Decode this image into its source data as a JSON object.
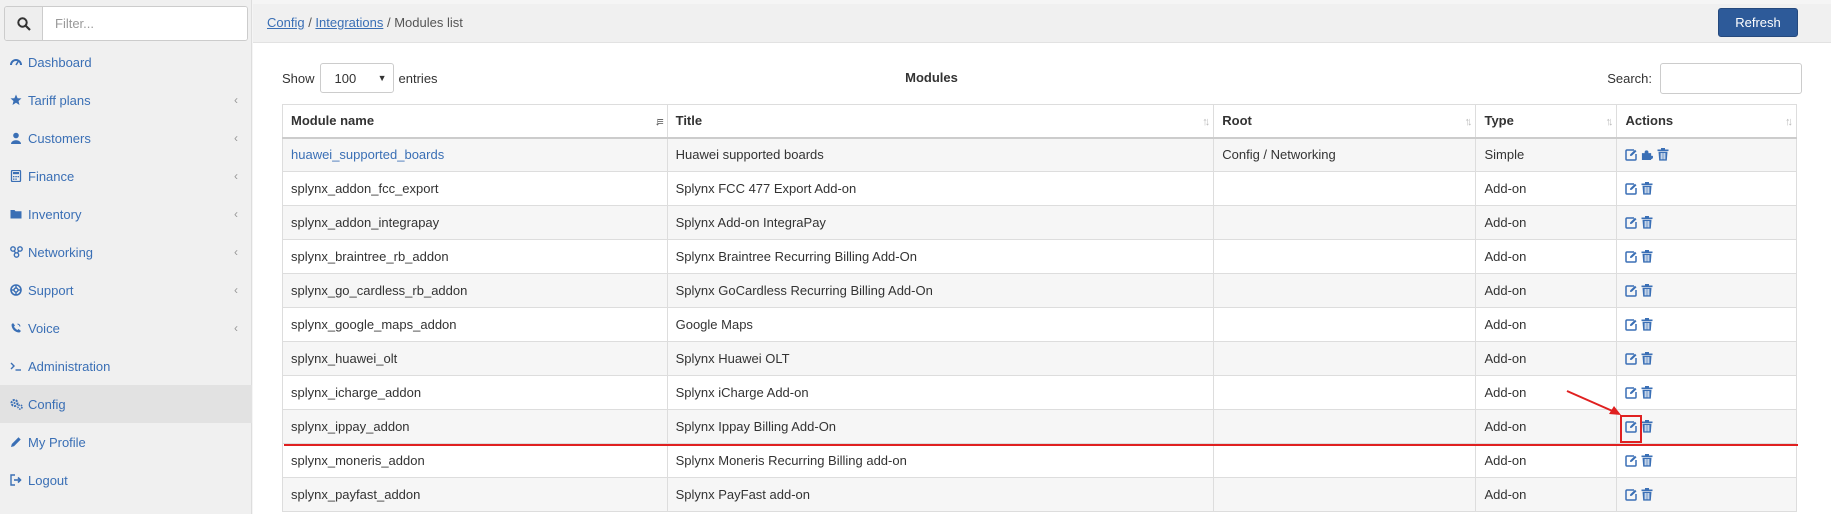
{
  "sidebar": {
    "filter_placeholder": "Filter...",
    "items": [
      {
        "label": "Dashboard",
        "icon": "dashboard-icon",
        "has_chevron": false
      },
      {
        "label": "Tariff plans",
        "icon": "star-icon",
        "has_chevron": true
      },
      {
        "label": "Customers",
        "icon": "user-icon",
        "has_chevron": true
      },
      {
        "label": "Finance",
        "icon": "calculator-icon",
        "has_chevron": true
      },
      {
        "label": "Inventory",
        "icon": "folder-icon",
        "has_chevron": true
      },
      {
        "label": "Networking",
        "icon": "network-icon",
        "has_chevron": true
      },
      {
        "label": "Support",
        "icon": "lifebuoy-icon",
        "has_chevron": true
      },
      {
        "label": "Voice",
        "icon": "phone-icon",
        "has_chevron": true
      },
      {
        "label": "Administration",
        "icon": "terminal-icon",
        "has_chevron": false
      },
      {
        "label": "Config",
        "icon": "gears-icon",
        "has_chevron": false,
        "active": true
      },
      {
        "label": "My Profile",
        "icon": "pencil-icon",
        "has_chevron": false
      },
      {
        "label": "Logout",
        "icon": "logout-icon",
        "has_chevron": false
      }
    ]
  },
  "header": {
    "breadcrumb": {
      "config": "Config",
      "sep1": " / ",
      "integrations": "Integrations",
      "sep2": " / ",
      "current": "Modules list"
    },
    "refresh_label": "Refresh"
  },
  "table": {
    "show_label": "Show",
    "entries_value": "100",
    "entries_label": "entries",
    "title": "Modules",
    "search_label": "Search:",
    "columns": [
      "Module name",
      "Title",
      "Root",
      "Type",
      "Actions"
    ],
    "rows": [
      {
        "name": "huawei_supported_boards",
        "title": "Huawei supported boards",
        "root": "Config / Networking",
        "type": "Simple",
        "link": true,
        "extra_action": true
      },
      {
        "name": "splynx_addon_fcc_export",
        "title": "Splynx FCC 477 Export Add-on",
        "root": "",
        "type": "Add-on"
      },
      {
        "name": "splynx_addon_integrapay",
        "title": "Splynx Add-on IntegraPay",
        "root": "",
        "type": "Add-on"
      },
      {
        "name": "splynx_braintree_rb_addon",
        "title": "Splynx Braintree Recurring Billing Add-On",
        "root": "",
        "type": "Add-on"
      },
      {
        "name": "splynx_go_cardless_rb_addon",
        "title": "Splynx GoCardless Recurring Billing Add-On",
        "root": "",
        "type": "Add-on"
      },
      {
        "name": "splynx_google_maps_addon",
        "title": "Google Maps",
        "root": "",
        "type": "Add-on"
      },
      {
        "name": "splynx_huawei_olt",
        "title": "Splynx Huawei OLT",
        "root": "",
        "type": "Add-on"
      },
      {
        "name": "splynx_icharge_addon",
        "title": "Splynx iCharge Add-on",
        "root": "",
        "type": "Add-on"
      },
      {
        "name": "splynx_ippay_addon",
        "title": "Splynx Ippay Billing Add-On",
        "root": "",
        "type": "Add-on",
        "highlighted": true
      },
      {
        "name": "splynx_moneris_addon",
        "title": "Splynx Moneris Recurring Billing add-on",
        "root": "",
        "type": "Add-on"
      },
      {
        "name": "splynx_payfast_addon",
        "title": "Splynx PayFast add-on",
        "root": "",
        "type": "Add-on"
      }
    ]
  },
  "colors": {
    "link": "#3a6fb5",
    "primary_button": "#2d5a99",
    "highlight": "#e02020"
  }
}
